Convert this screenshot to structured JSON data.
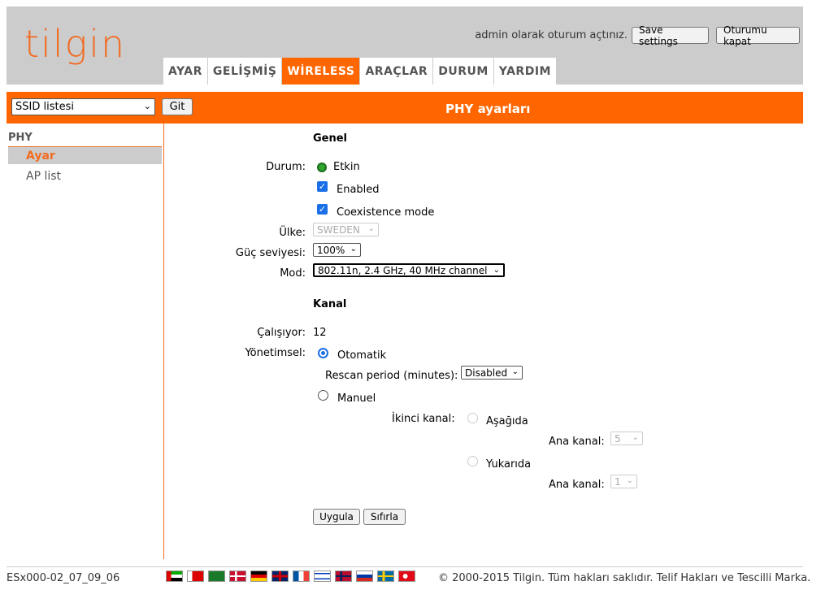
{
  "header": {
    "logo_text": "tilgin",
    "user_text": "admin olarak oturum açtınız.",
    "save_label": "Save settings",
    "logout_label": "Oturumu kapat"
  },
  "nav": {
    "tabs": [
      {
        "label": "AYAR",
        "active": false
      },
      {
        "label": "GELİŞMİŞ",
        "active": false
      },
      {
        "label": "WİRELESS",
        "active": true
      },
      {
        "label": "ARAÇLAR",
        "active": false
      },
      {
        "label": "DURUM",
        "active": false
      },
      {
        "label": "YARDIM",
        "active": false
      }
    ]
  },
  "toolbar": {
    "ssid_select_value": "SSID listesi",
    "go_label": "Git",
    "page_title": "PHY ayarları"
  },
  "sidebar": {
    "heading": "PHY",
    "items": [
      {
        "label": "Ayar",
        "active": true
      },
      {
        "label": "AP list",
        "active": false
      }
    ]
  },
  "form": {
    "general_heading": "Genel",
    "status_label": "Durum:",
    "status_value": "Etkin",
    "enabled_label": "Enabled",
    "coexistence_label": "Coexistence mode",
    "country_label": "Ülke:",
    "country_value": "SWEDEN",
    "power_label": "Güç seviyesi:",
    "power_value": "100%",
    "mode_label": "Mod:",
    "mode_value": "802.11n, 2.4 GHz, 40 MHz channel",
    "channel_heading": "Kanal",
    "running_label": "Çalışıyor:",
    "running_value": "12",
    "admin_label": "Yönetimsel:",
    "auto_label": "Otomatik",
    "rescan_label": "Rescan period (minutes):",
    "rescan_value": "Disabled",
    "manual_label": "Manuel",
    "second_channel_label": "İkinci kanal:",
    "below_label": "Aşağıda",
    "main_channel_label": "Ana kanal:",
    "main_channel_below_value": "5",
    "above_label": "Yukarıda",
    "main_channel_above_value": "1",
    "apply_label": "Uygula",
    "reset_label": "Sıfırla"
  },
  "footer": {
    "version": "ESx000-02_07_09_06",
    "copyright": "© 2000-2015 Tilgin. Tüm hakları saklıdır. Telif Hakları ve Tescilli Marka.",
    "flags": [
      "flag-uae-icon",
      "flag-bahrain-icon",
      "flag-saudi-icon",
      "flag-denmark-icon",
      "flag-germany-icon",
      "flag-uk-icon",
      "flag-france-icon",
      "flag-israel-icon",
      "flag-norway-icon",
      "flag-russia-icon",
      "flag-sweden-icon",
      "flag-turkey-icon"
    ]
  },
  "colors": {
    "accent": "#ff6600",
    "header_bg": "#cccccc"
  }
}
